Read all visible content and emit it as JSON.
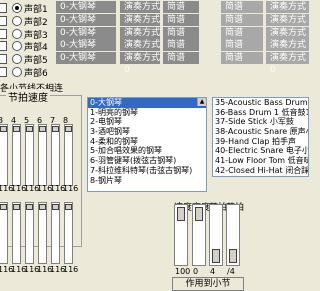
{
  "parts": [
    {
      "label": "声部1",
      "checked": false,
      "selected": true,
      "instrument": "0-大钢琴",
      "mode": "演奏方式 0",
      "mode2": "简谱",
      "right1": "简谱",
      "right2": "演奏方式 0"
    },
    {
      "label": "声部2",
      "checked": false,
      "selected": false,
      "instrument": "0-大钢琴",
      "mode": "演奏方式 0",
      "mode2": "简谱",
      "right1": "简谱",
      "right2": "演奏方式 0"
    },
    {
      "label": "声部3",
      "checked": false,
      "selected": false,
      "instrument": "0-大钢琴",
      "mode": "演奏方式 0",
      "mode2": "简谱",
      "right1": "简谱",
      "right2": "演奏方式 0"
    },
    {
      "label": "声部4",
      "checked": false,
      "selected": false,
      "instrument": "0-大钢琴",
      "mode": "演奏方式 0",
      "mode2": "简谱",
      "right1": "简谱",
      "right2": "演奏方式 0"
    },
    {
      "label": "声部5",
      "checked": false,
      "selected": false,
      "instrument": "0-大钢琴",
      "mode": "演奏方式 0",
      "mode2": "简谱",
      "right1": "简谱",
      "right2": "演奏方式 0"
    },
    {
      "label": "声部6",
      "checked": false,
      "selected": false,
      "instrument": "",
      "mode": "",
      "mode2": "",
      "right1": "",
      "right2": ""
    }
  ],
  "no_split_label": "各小节线不相连",
  "tempo_group_title": "节拍速度",
  "tempo_ticks": [
    "3",
    "4",
    "5",
    "6",
    "7",
    "8"
  ],
  "tempo_values_top": [
    "116",
    "116",
    "116",
    "116",
    "116",
    "116"
  ],
  "tempo_values_bottom": [
    "116",
    "116",
    "116",
    "116",
    "116",
    "116"
  ],
  "instrument_list": [
    "0-大钢琴",
    "1-明亮的钢琴",
    "2-电钢琴",
    "3-酒吧钢琴",
    "4-柔和的钢琴",
    "5-加合唱效果的钢琴",
    "6-羽管键琴(拨弦古钢琴)",
    "7-科拉维科特琴(击弦古钢琴)",
    "8-钢片琴"
  ],
  "instrument_selected_index": 0,
  "drum_list": [
    "35-Acoustic Bass Drum  低",
    "36-Bass Drum 1  低音鼓1",
    "37-Side Stick  小军鼓",
    "38-Acoustic Snare  原声小军鼓",
    "39-Hand Clap  拍手声",
    "40-Electric Snare  电子小军鼓",
    "41-Low Floor Tom  低音嗵鼓",
    "42-Closed Hi-Hat  闭合踩镲",
    "43-High Floor Tom  高音嗵鼓"
  ],
  "slider_labels": [
    "速度",
    "高度",
    "节拍",
    "节拍"
  ],
  "slider_values": [
    "100",
    "0",
    "4",
    "/4"
  ],
  "apply_button": "作用到小节"
}
